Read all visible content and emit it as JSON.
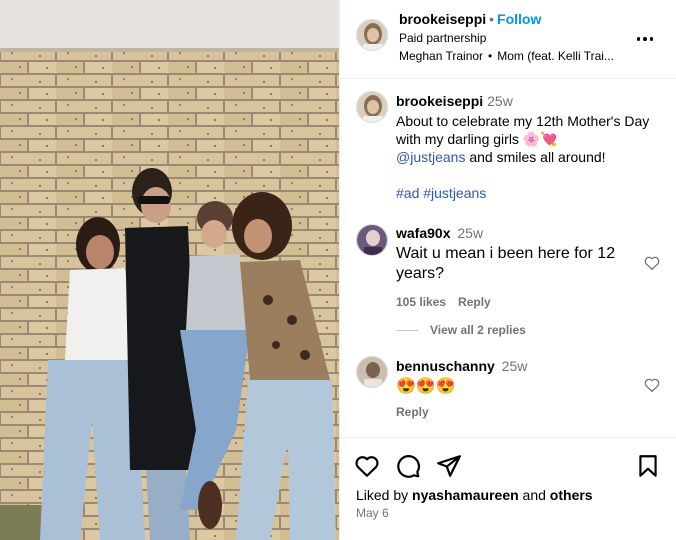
{
  "header": {
    "username": "brookeiseppi",
    "separator": "•",
    "follow_label": "Follow",
    "paid_partnership": "Paid partnership",
    "music_artist": "Meghan Trainor",
    "music_sep": "•",
    "music_title": "Mom (feat. Kelli Trai...",
    "more_icon": "more-horizontal-icon"
  },
  "caption": {
    "username": "brookeiseppi",
    "time": "25w",
    "text_before": "About to celebrate my 12th Mother's Day with my darling girls 🌸💘",
    "mention": "@justjeans",
    "text_after": " and smiles all around!",
    "tag1": "#ad",
    "tag2": "#justjeans"
  },
  "comments": [
    {
      "username": "wafa90x",
      "time": "25w",
      "text": "Wait u mean i been here for 12 years?",
      "likes": "105 likes",
      "reply_label": "Reply",
      "view_replies": "View all 2 replies"
    },
    {
      "username": "bennuschanny",
      "time": "25w",
      "text": "😍😍😍",
      "reply_label": "Reply"
    }
  ],
  "footer": {
    "liked_prefix": "Liked by ",
    "liked_user": "nyashamaureen",
    "liked_and": " and ",
    "liked_others": "others",
    "date": "May 6"
  },
  "icons": [
    "heart-icon",
    "comment-icon",
    "share-icon",
    "save-bookmark-icon"
  ],
  "colors": {
    "follow_blue": "#0095f6",
    "link_blue": "#2e58b8",
    "secondary_text": "#737373",
    "divider": "#efefef"
  }
}
